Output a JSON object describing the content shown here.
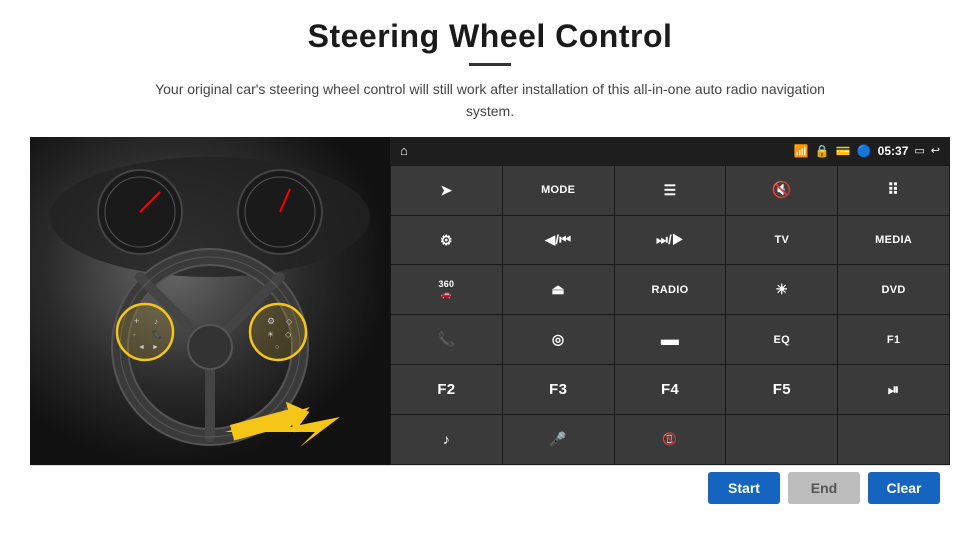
{
  "page": {
    "title": "Steering Wheel Control",
    "subtitle": "Your original car's steering wheel control will still work after installation of this all-in-one auto radio navigation system."
  },
  "status_bar": {
    "time": "05:37"
  },
  "grid_buttons": [
    {
      "id": "nav",
      "label": "",
      "icon": "➤",
      "row": 1,
      "col": 1
    },
    {
      "id": "mode",
      "label": "MODE",
      "icon": "",
      "row": 1,
      "col": 2
    },
    {
      "id": "list",
      "label": "",
      "icon": "≡",
      "row": 1,
      "col": 3
    },
    {
      "id": "mute",
      "label": "",
      "icon": "🔇",
      "row": 1,
      "col": 4
    },
    {
      "id": "apps",
      "label": "",
      "icon": "⠿",
      "row": 1,
      "col": 5
    },
    {
      "id": "settings",
      "label": "",
      "icon": "⚙",
      "row": 2,
      "col": 1
    },
    {
      "id": "prev",
      "label": "",
      "icon": "⏮",
      "row": 2,
      "col": 2
    },
    {
      "id": "next",
      "label": "",
      "icon": "⏭",
      "row": 2,
      "col": 3
    },
    {
      "id": "tv",
      "label": "TV",
      "icon": "",
      "row": 2,
      "col": 4
    },
    {
      "id": "media",
      "label": "MEDIA",
      "icon": "",
      "row": 2,
      "col": 5
    },
    {
      "id": "360cam",
      "label": "360",
      "icon": "",
      "row": 3,
      "col": 1
    },
    {
      "id": "eject",
      "label": "",
      "icon": "⏏",
      "row": 3,
      "col": 2
    },
    {
      "id": "radio",
      "label": "RADIO",
      "icon": "",
      "row": 3,
      "col": 3
    },
    {
      "id": "brightness",
      "label": "",
      "icon": "☀",
      "row": 3,
      "col": 4
    },
    {
      "id": "dvd",
      "label": "DVD",
      "icon": "",
      "row": 3,
      "col": 5
    },
    {
      "id": "phone",
      "label": "",
      "icon": "📞",
      "row": 4,
      "col": 1
    },
    {
      "id": "navigation2",
      "label": "",
      "icon": "◎",
      "row": 4,
      "col": 2
    },
    {
      "id": "screen",
      "label": "",
      "icon": "▬",
      "row": 4,
      "col": 3
    },
    {
      "id": "eq",
      "label": "EQ",
      "icon": "",
      "row": 4,
      "col": 4
    },
    {
      "id": "f1",
      "label": "F1",
      "icon": "",
      "row": 4,
      "col": 5
    },
    {
      "id": "f2",
      "label": "F2",
      "icon": "",
      "row": 5,
      "col": 1
    },
    {
      "id": "f3",
      "label": "F3",
      "icon": "",
      "row": 5,
      "col": 2
    },
    {
      "id": "f4",
      "label": "F4",
      "icon": "",
      "row": 5,
      "col": 3
    },
    {
      "id": "f5",
      "label": "F5",
      "icon": "",
      "row": 5,
      "col": 4
    },
    {
      "id": "playpause",
      "label": "",
      "icon": "⏯",
      "row": 5,
      "col": 5
    },
    {
      "id": "music",
      "label": "",
      "icon": "♪",
      "row": 6,
      "col": 1
    },
    {
      "id": "mic",
      "label": "",
      "icon": "🎤",
      "row": 6,
      "col": 2
    },
    {
      "id": "callend",
      "label": "",
      "icon": "📵",
      "row": 6,
      "col": 3
    },
    {
      "id": "empty1",
      "label": "",
      "icon": "",
      "row": 6,
      "col": 4
    },
    {
      "id": "empty2",
      "label": "",
      "icon": "",
      "row": 6,
      "col": 5
    }
  ],
  "action_buttons": {
    "start": "Start",
    "end": "End",
    "clear": "Clear"
  }
}
